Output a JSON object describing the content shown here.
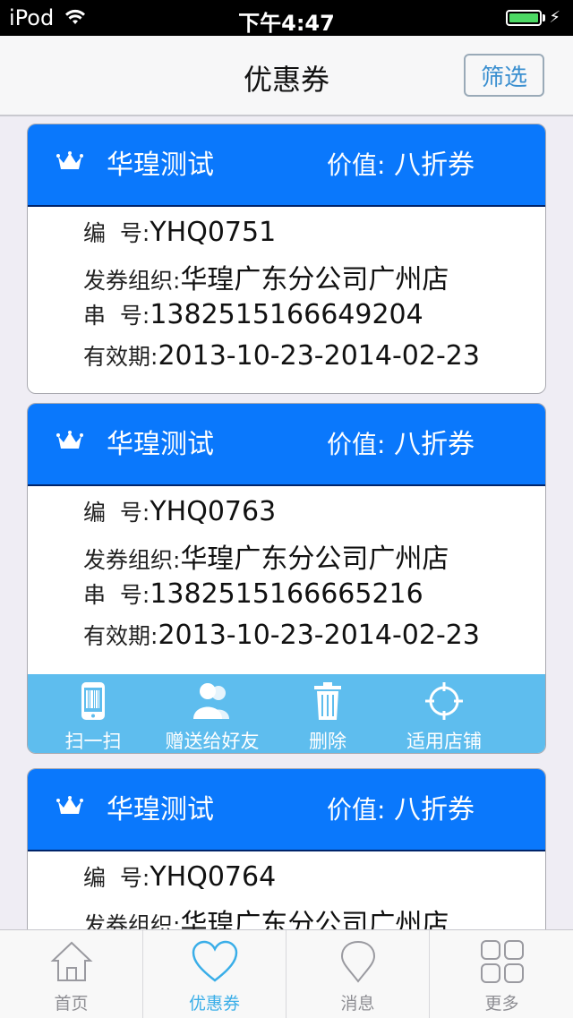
{
  "status": {
    "carrier": "iPod",
    "time": "下午4:47"
  },
  "nav": {
    "title": "优惠券",
    "filter_label": "筛选"
  },
  "labels": {
    "number": "编  号:",
    "org": "发券组织:",
    "serial": "串  号:",
    "validity": "有效期:",
    "value": "价值:"
  },
  "coupons": [
    {
      "name": "华瑝测试",
      "value": "八折券",
      "number": "YHQ0751",
      "org": "华瑝广东分公司广州店",
      "serial": "1382515166649204",
      "validity": "2013-10-23-2014-02-23"
    },
    {
      "name": "华瑝测试",
      "value": "八折券",
      "number": "YHQ0763",
      "org": "华瑝广东分公司广州店",
      "serial": "1382515166665216",
      "validity": "2013-10-23-2014-02-23"
    },
    {
      "name": "华瑝测试",
      "value": "八折券",
      "number": "YHQ0764",
      "org": "华瑝广东分公司广州店"
    }
  ],
  "actions": {
    "scan": "扫一扫",
    "gift": "赠送给好友",
    "delete": "删除",
    "stores": "适用店铺"
  },
  "tabs": {
    "home": "首页",
    "coupons": "优惠券",
    "messages": "消息",
    "more": "更多"
  },
  "colors": {
    "card_header": "#0a78fc",
    "action_bar": "#5ebdee",
    "active_tab": "#3aaee8"
  }
}
